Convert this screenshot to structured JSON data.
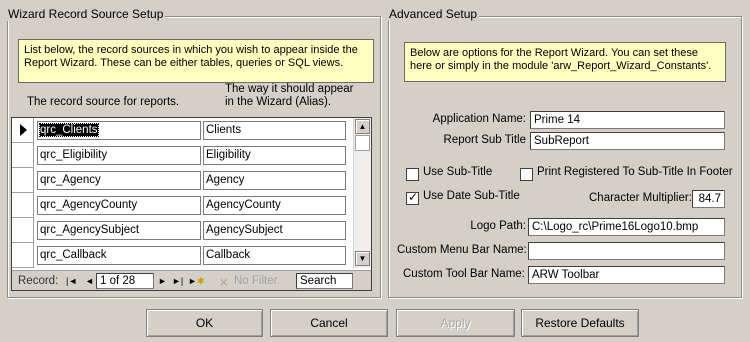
{
  "left_panel": {
    "title": "Wizard Record Source Setup",
    "note": "List below, the record sources in which you wish to appear inside the Report Wizard.  These can be either tables, queries or SQL views.",
    "col_source_header": "The record source for reports.",
    "col_alias_header": "The way it should appear in the Wizard (Alias).",
    "rows": [
      {
        "source": "qrc_Clients",
        "alias": "Clients",
        "current": true
      },
      {
        "source": "qrc_Eligibility",
        "alias": "Eligibility",
        "current": false
      },
      {
        "source": "qrc_Agency",
        "alias": "Agency",
        "current": false
      },
      {
        "source": "qrc_AgencyCounty",
        "alias": "AgencyCounty",
        "current": false
      },
      {
        "source": "qrc_AgencySubject",
        "alias": "AgencySubject",
        "current": false
      },
      {
        "source": "qrc_Callback",
        "alias": "Callback",
        "current": false
      }
    ],
    "nav": {
      "record_label": "Record:",
      "position": "1 of 28",
      "filter_label": "No Filter",
      "search_placeholder": "Search"
    }
  },
  "right_panel": {
    "title": "Advanced Setup",
    "note": "Below are options for the Report Wizard.  You can set these here or simply in the module 'arw_Report_Wizard_Constants'.",
    "application_name_label": "Application Name:",
    "application_name_value": "Prime 14",
    "report_sub_title_label": "Report Sub Title",
    "report_sub_title_value": "SubReport",
    "use_sub_title_label": "Use Sub-Title",
    "use_sub_title_checked": false,
    "print_registered_label": "Print Registered To Sub-Title In Footer",
    "print_registered_checked": false,
    "use_date_sub_title_label": "Use Date Sub-Title",
    "use_date_sub_title_checked": true,
    "character_multiplier_label": "Character Multiplier:",
    "character_multiplier_value": "84.7",
    "logo_path_label": "Logo Path:",
    "logo_path_value": "C:\\Logo_rc\\Prime16Logo10.bmp",
    "custom_menu_bar_label": "Custom Menu Bar Name:",
    "custom_menu_bar_value": "",
    "custom_tool_bar_label": "Custom Tool Bar Name:",
    "custom_tool_bar_value": "ARW Toolbar"
  },
  "buttons": {
    "ok": "OK",
    "cancel": "Cancel",
    "apply": "Apply",
    "restore_defaults": "Restore Defaults"
  },
  "icons": {
    "record_selector": "current-record-arrow-icon",
    "first": "first-record-icon",
    "prev": "previous-record-icon",
    "next": "next-record-icon",
    "last": "last-record-icon",
    "new": "new-record-icon",
    "filter": "no-filter-icon",
    "scroll_up": "scroll-up-icon",
    "scroll_down": "scroll-down-icon"
  }
}
